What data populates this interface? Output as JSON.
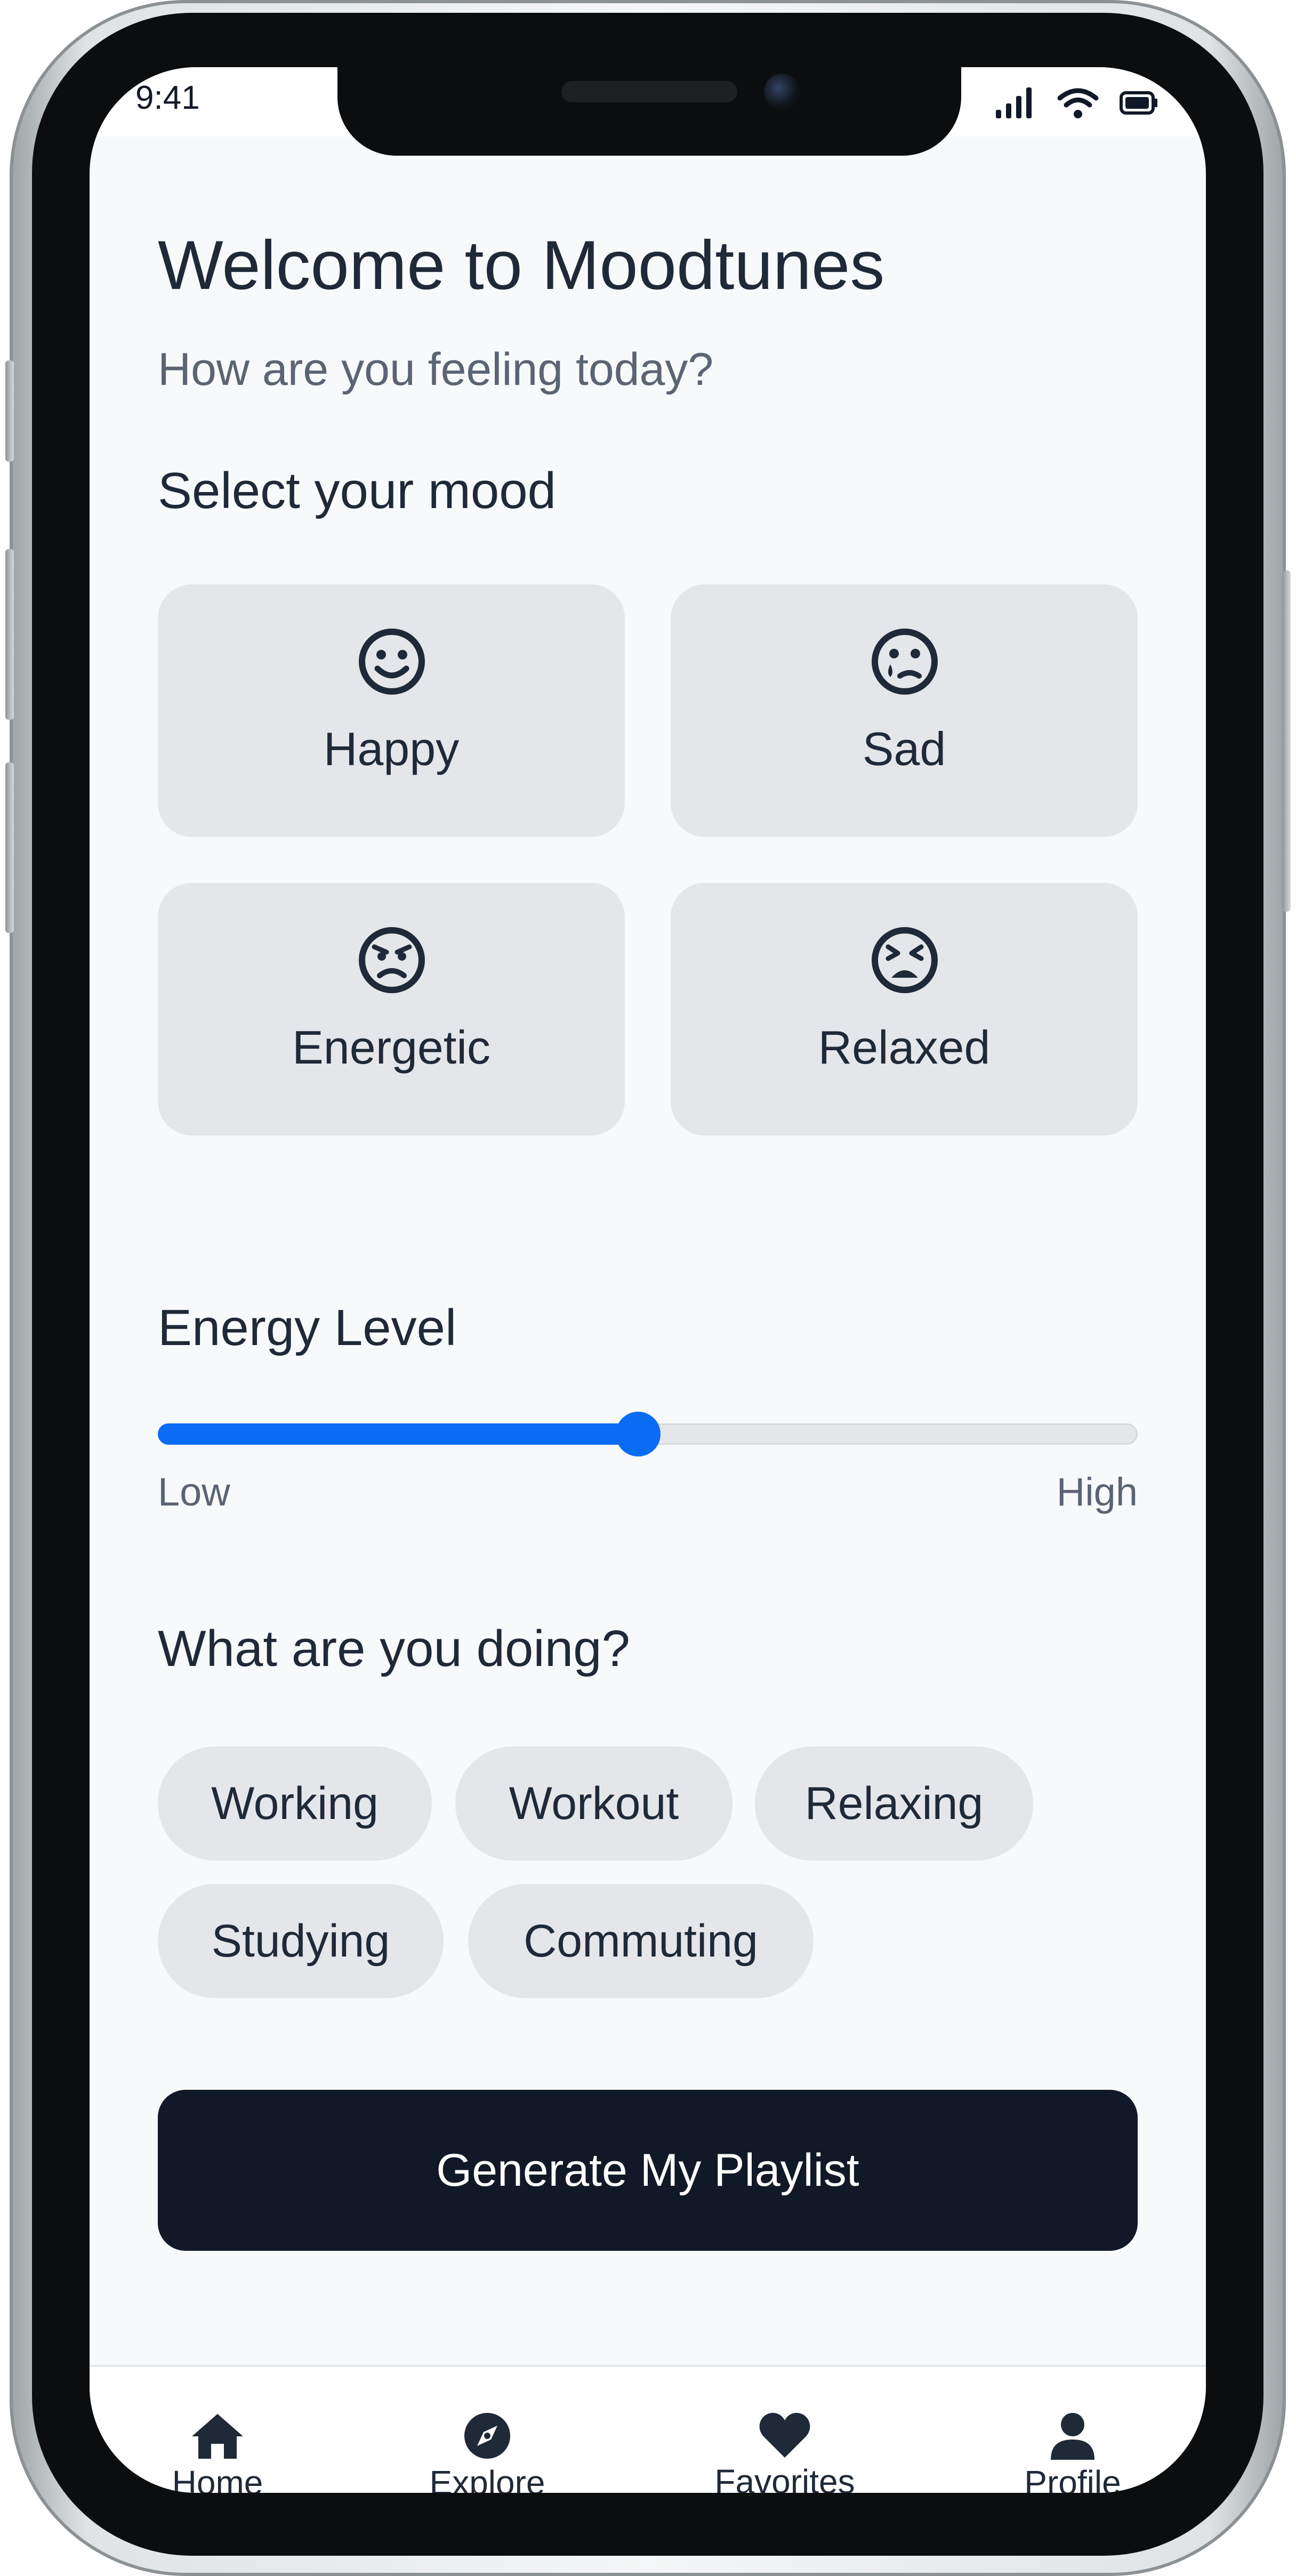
{
  "status_bar": {
    "time": "9:41"
  },
  "header": {
    "title": "Welcome to Moodtunes",
    "subtitle": "How are you feeling today?"
  },
  "mood_section": {
    "label": "Select your mood",
    "moods": [
      {
        "label": "Happy",
        "icon": "smile-icon"
      },
      {
        "label": "Sad",
        "icon": "sad-tear-icon"
      },
      {
        "label": "Energetic",
        "icon": "angry-icon"
      },
      {
        "label": "Relaxed",
        "icon": "tired-icon"
      }
    ]
  },
  "energy": {
    "label": "Energy Level",
    "low_label": "Low",
    "high_label": "High",
    "value": 0.49
  },
  "activity": {
    "label": "What are you doing?",
    "chips": [
      "Working",
      "Workout",
      "Relaxing",
      "Studying",
      "Commuting"
    ]
  },
  "cta": {
    "label": "Generate My Playlist"
  },
  "tab_bar": {
    "tabs": [
      {
        "label": "Home",
        "icon": "home-icon"
      },
      {
        "label": "Explore",
        "icon": "compass-icon"
      },
      {
        "label": "Favorites",
        "icon": "heart-icon"
      },
      {
        "label": "Profile",
        "icon": "user-icon"
      }
    ]
  },
  "colors": {
    "accent": "#0a6cf5",
    "primary_dark": "#111827",
    "card_bg": "#e5e6e9",
    "screen_bg": "#f8f9fb"
  }
}
